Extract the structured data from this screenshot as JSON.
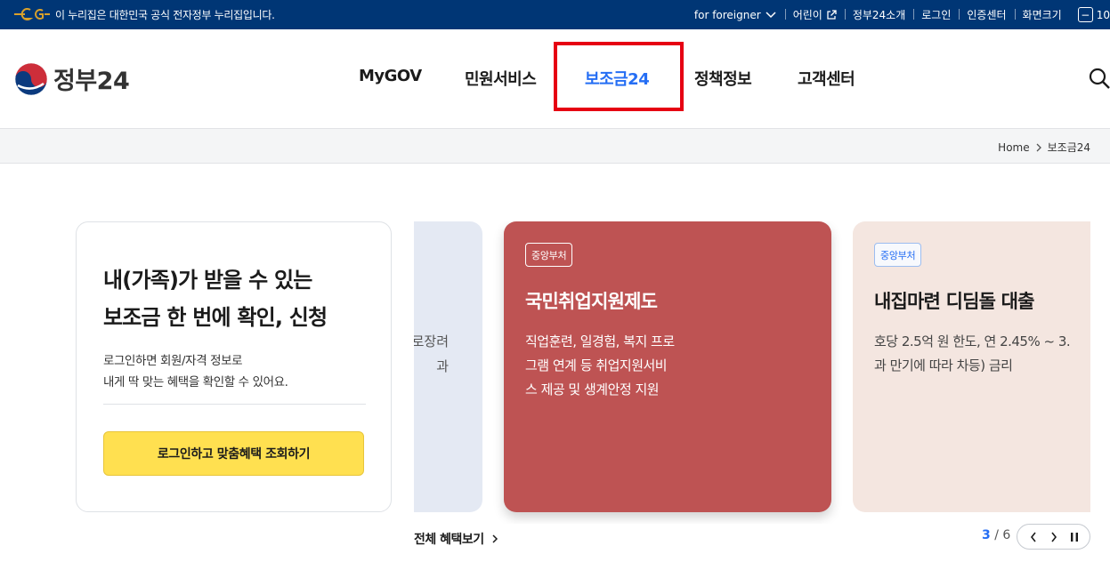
{
  "gov_bar": {
    "notice": "이 누리집은 대한민국 공식 전자정부 누리집입니다.",
    "links": [
      "for foreigner",
      "어린이",
      "정부24소개",
      "로그인",
      "인증센터",
      "화면크기",
      "10"
    ]
  },
  "header": {
    "logo_text": "정부24",
    "nav": [
      "MyGOV",
      "민원서비스",
      "보조금24",
      "정책정보",
      "고객센터"
    ],
    "active_nav": "보조금24"
  },
  "breadcrumb": {
    "home": "Home",
    "current": "보조금24"
  },
  "intro": {
    "headline_line1": "내(가족)가 받을 수 있는",
    "headline_line2": "보조금 한 번에 확인, 신청",
    "desc_line1": "로그인하면 회원/자격 정보로",
    "desc_line2": "내게 딱 맞는 혜택을 확인할 수 있어요.",
    "login_button": "로그인하고 맞춤혜택 조회하기"
  },
  "cards": {
    "prev_fragment1": "로장려",
    "prev_fragment2": "과",
    "main": {
      "badge": "중앙부처",
      "title": "국민취업지원제도",
      "desc_line1": "직업훈련, 일경험, 복지 프로",
      "desc_line2": "그램 연계 등 취업지원서비",
      "desc_line3": "스 제공 및 생계안정 지원"
    },
    "next": {
      "badge": "중앙부처",
      "title": "내집마련 디딤돌 대출",
      "desc_line1": "호당 2.5억 원 한도, 연 2.45% ~ 3.",
      "desc_line2": "과 만기에 따라 차등) 금리"
    }
  },
  "footer": {
    "all_link": "전체 혜택보기",
    "page_current": "3",
    "page_sep": "/",
    "page_total": "6"
  },
  "colors": {
    "gov_bar": "#003675",
    "accent": "#256ef4",
    "highlight": "#e60012",
    "main_card": "#be5353",
    "login_button": "#ffe050"
  }
}
